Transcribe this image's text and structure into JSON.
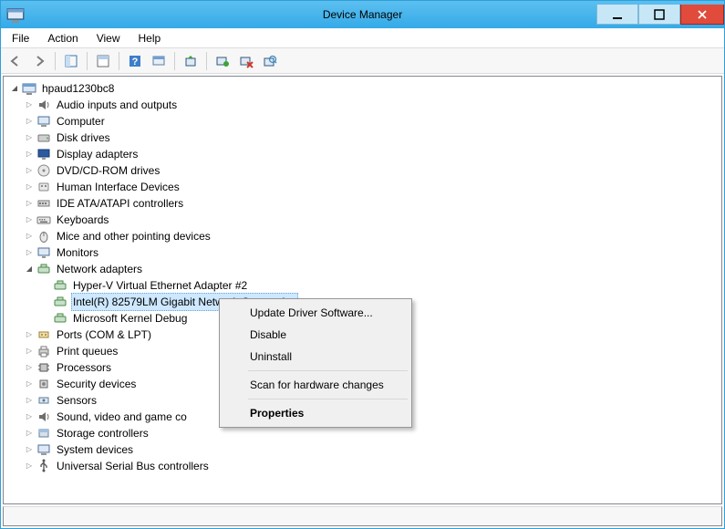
{
  "title": "Device Manager",
  "menus": {
    "file": "File",
    "action": "Action",
    "view": "View",
    "help": "Help"
  },
  "toolbar_icons": [
    "back",
    "forward",
    "show-containers",
    "properties",
    "help",
    "options",
    "refresh",
    "update",
    "uninstall",
    "scan"
  ],
  "root": "hpaud1230bc8",
  "categories": [
    {
      "label": "Audio inputs and outputs",
      "icon": "audio-icon",
      "expanded": false
    },
    {
      "label": "Computer",
      "icon": "computer-icon",
      "expanded": false
    },
    {
      "label": "Disk drives",
      "icon": "disk-icon",
      "expanded": false
    },
    {
      "label": "Display adapters",
      "icon": "display-icon",
      "expanded": false
    },
    {
      "label": "DVD/CD-ROM drives",
      "icon": "optical-icon",
      "expanded": false
    },
    {
      "label": "Human Interface Devices",
      "icon": "hid-icon",
      "expanded": false
    },
    {
      "label": "IDE ATA/ATAPI controllers",
      "icon": "ide-icon",
      "expanded": false
    },
    {
      "label": "Keyboards",
      "icon": "keyboard-icon",
      "expanded": false
    },
    {
      "label": "Mice and other pointing devices",
      "icon": "mouse-icon",
      "expanded": false
    },
    {
      "label": "Monitors",
      "icon": "monitor-icon",
      "expanded": false
    },
    {
      "label": "Network adapters",
      "icon": "network-icon",
      "expanded": true,
      "children": [
        "Hyper-V Virtual Ethernet Adapter #2",
        "Intel(R) 82579LM Gigabit Network Connection",
        "Microsoft Kernel Debug Network Adapter"
      ],
      "selected_child_index": 1,
      "truncated_child_2": "Microsoft Kernel Debug"
    },
    {
      "label": "Ports (COM & LPT)",
      "icon": "ports-icon",
      "expanded": false
    },
    {
      "label": "Print queues",
      "icon": "printer-icon",
      "expanded": false
    },
    {
      "label": "Processors",
      "icon": "processor-icon",
      "expanded": false
    },
    {
      "label": "Security devices",
      "icon": "security-icon",
      "expanded": false
    },
    {
      "label": "Sensors",
      "icon": "sensor-icon",
      "expanded": false
    },
    {
      "label": "Sound, video and game controllers",
      "icon": "sound-icon",
      "expanded": false,
      "truncated": "Sound, video and game co"
    },
    {
      "label": "Storage controllers",
      "icon": "storage-icon",
      "expanded": false
    },
    {
      "label": "System devices",
      "icon": "system-icon",
      "expanded": false
    },
    {
      "label": "Universal Serial Bus controllers",
      "icon": "usb-icon",
      "expanded": false
    }
  ],
  "context_menu": {
    "update": "Update Driver Software...",
    "disable": "Disable",
    "uninstall": "Uninstall",
    "scan": "Scan for hardware changes",
    "properties": "Properties"
  }
}
